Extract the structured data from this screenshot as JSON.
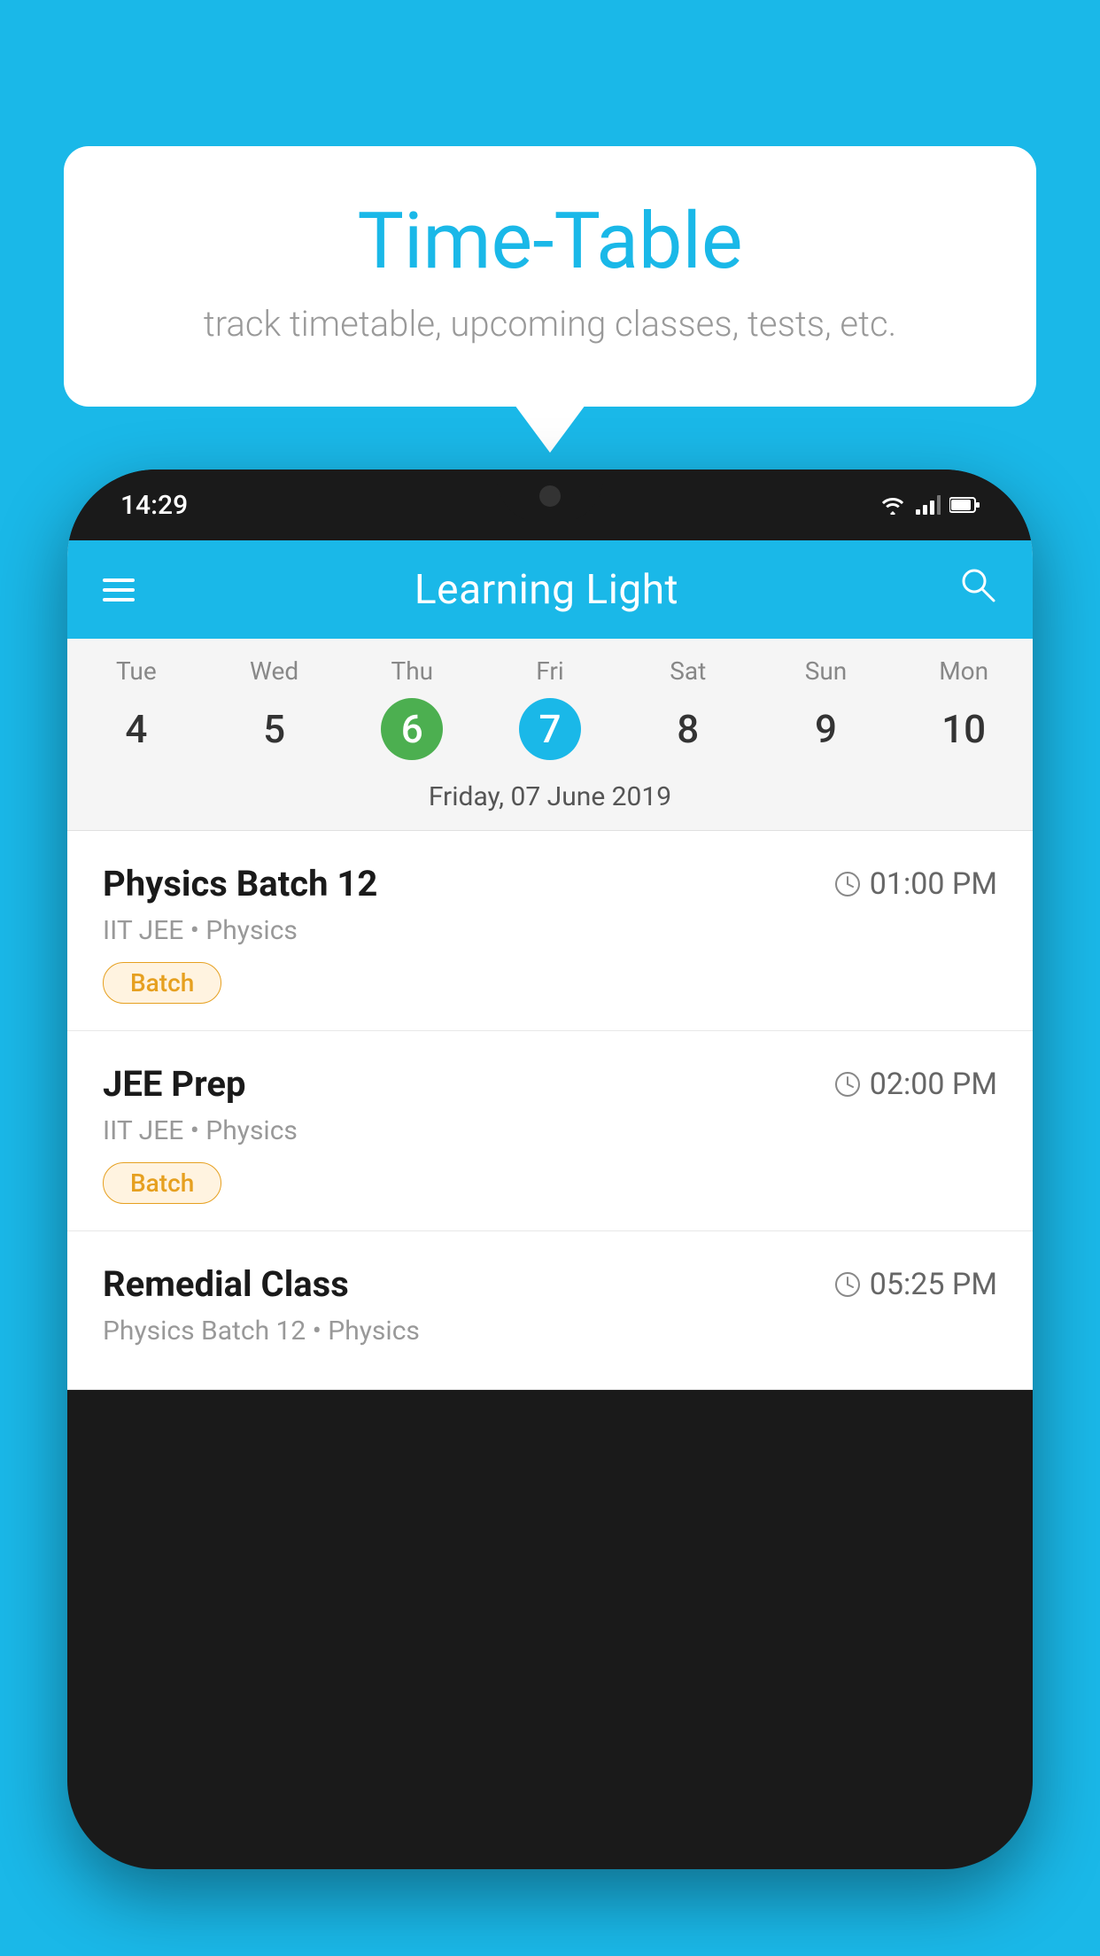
{
  "background_color": "#1ab8e8",
  "bubble": {
    "title": "Time-Table",
    "subtitle": "track timetable, upcoming classes, tests, etc."
  },
  "phone": {
    "status_bar": {
      "time": "14:29",
      "icons": [
        "wifi",
        "signal",
        "battery"
      ]
    },
    "app": {
      "title": "Learning Light",
      "menu_icon": "hamburger",
      "search_icon": "search"
    },
    "calendar": {
      "days": [
        {
          "name": "Tue",
          "number": "4",
          "state": "normal"
        },
        {
          "name": "Wed",
          "number": "5",
          "state": "normal"
        },
        {
          "name": "Thu",
          "number": "6",
          "state": "today"
        },
        {
          "name": "Fri",
          "number": "7",
          "state": "selected"
        },
        {
          "name": "Sat",
          "number": "8",
          "state": "normal"
        },
        {
          "name": "Sun",
          "number": "9",
          "state": "normal"
        },
        {
          "name": "Mon",
          "number": "10",
          "state": "normal"
        }
      ],
      "selected_date_label": "Friday, 07 June 2019"
    },
    "schedule": [
      {
        "title": "Physics Batch 12",
        "time": "01:00 PM",
        "subtitle": "IIT JEE • Physics",
        "tag": "Batch"
      },
      {
        "title": "JEE Prep",
        "time": "02:00 PM",
        "subtitle": "IIT JEE • Physics",
        "tag": "Batch"
      },
      {
        "title": "Remedial Class",
        "time": "05:25 PM",
        "subtitle": "Physics Batch 12 • Physics",
        "tag": null
      }
    ]
  }
}
